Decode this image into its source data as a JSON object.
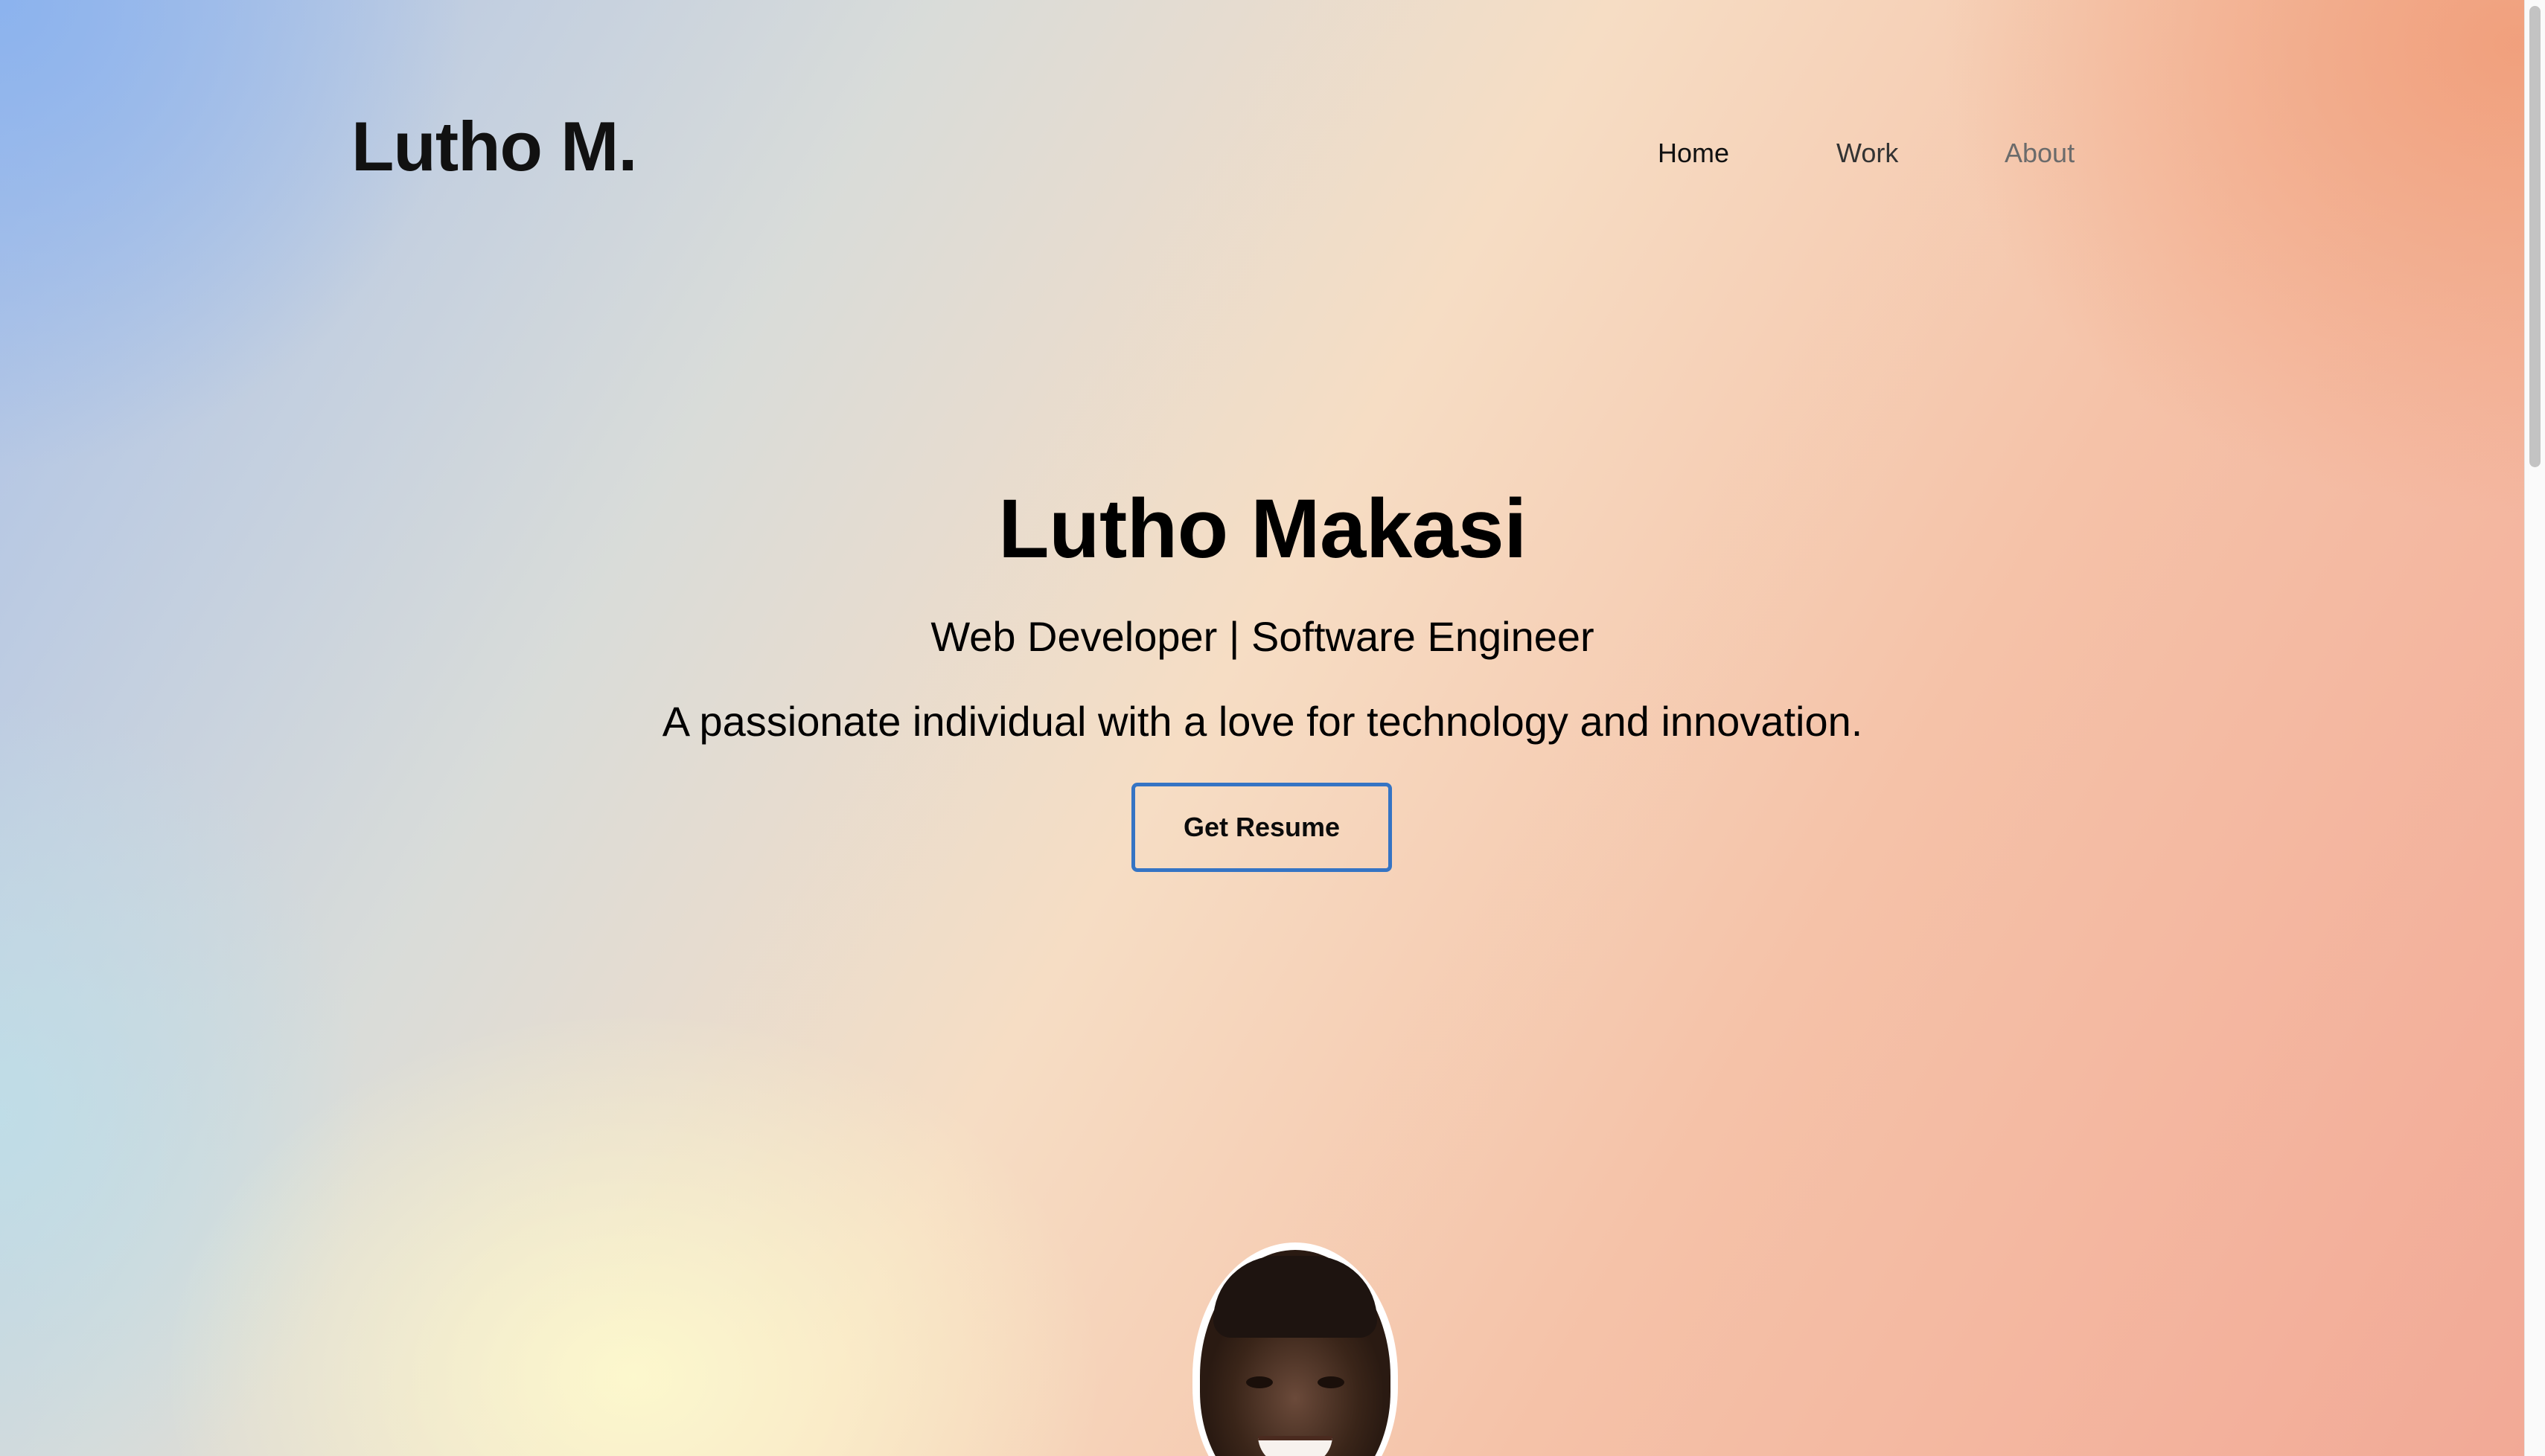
{
  "header": {
    "logo": "Lutho M.",
    "nav": {
      "home": "Home",
      "work": "Work",
      "about": "About"
    }
  },
  "hero": {
    "name": "Lutho Makasi",
    "role": "Web Developer | Software Engineer",
    "tagline": "A passionate individual with a love for technology and innovation.",
    "resume_label": "Get Resume"
  },
  "colors": {
    "button_border": "#3574c4",
    "bg_top_left": "#8ab2ee",
    "bg_top_right": "#f09b76",
    "bg_bottom_center": "#fdf9cd"
  },
  "icons": {
    "avatar": "profile-photo"
  }
}
